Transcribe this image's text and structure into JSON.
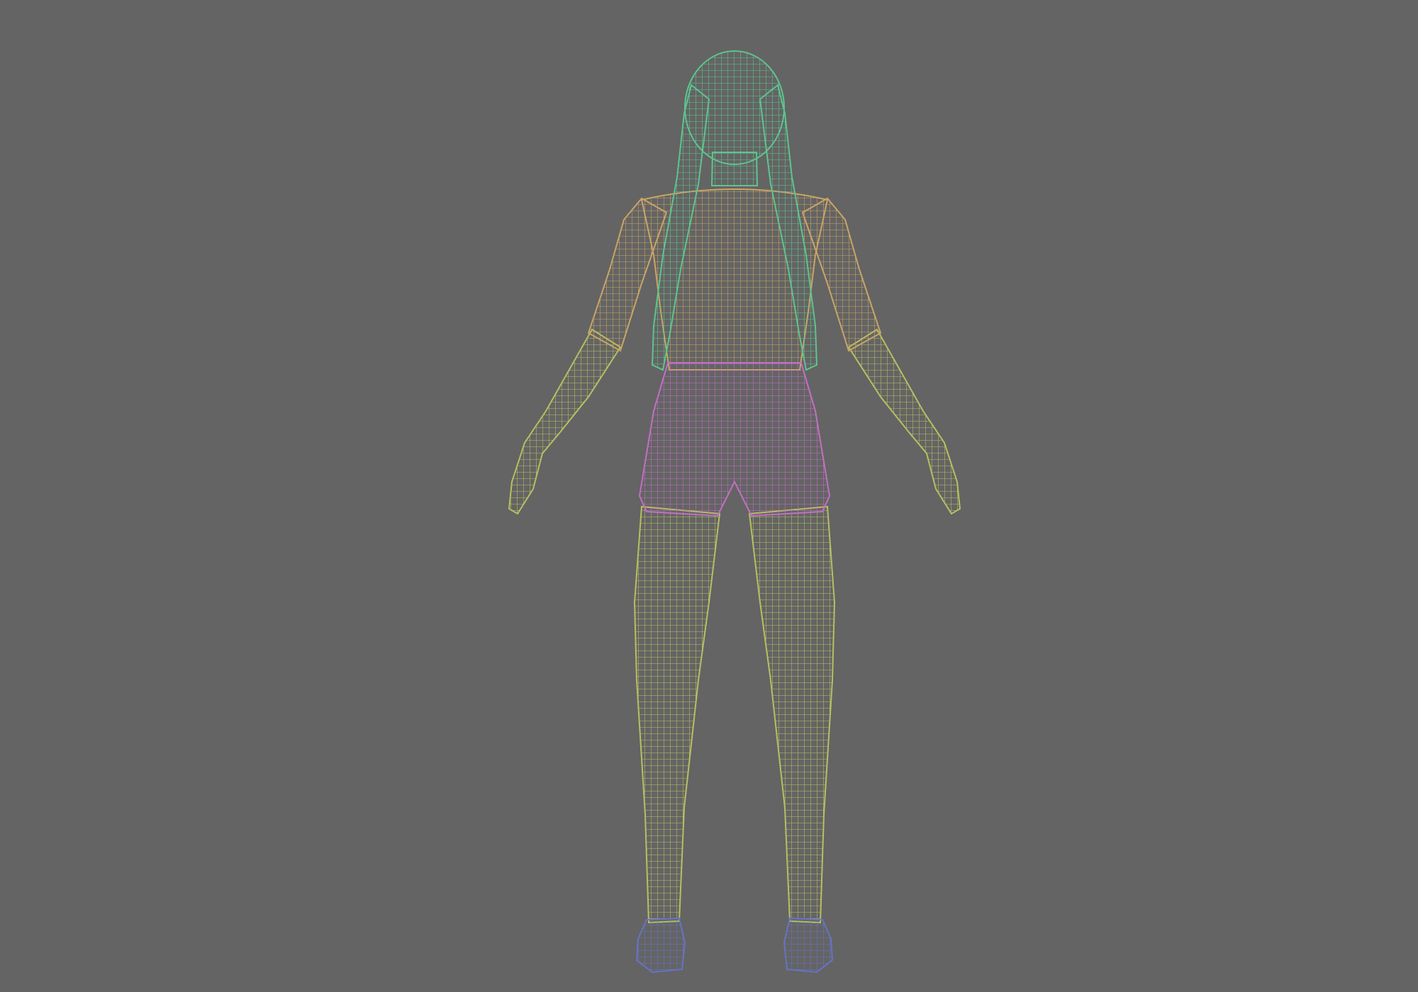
{
  "viewport": {
    "background_color": "#646464"
  },
  "model": {
    "parts": [
      {
        "name": "hair",
        "color": "#5ec48e"
      },
      {
        "name": "top",
        "color": "#c9a565"
      },
      {
        "name": "skin",
        "color": "#b7bf62"
      },
      {
        "name": "shorts",
        "color": "#c36fc4"
      },
      {
        "name": "shoes",
        "color": "#6673c4"
      }
    ]
  }
}
